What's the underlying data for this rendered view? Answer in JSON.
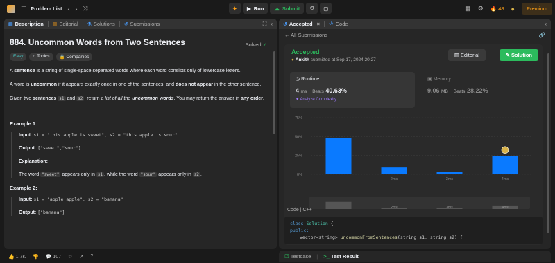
{
  "topbar": {
    "problem_list": "Problem List",
    "run": "Run",
    "submit": "Submit",
    "streak": "48",
    "premium": "Premium"
  },
  "left_tabs": [
    "Description",
    "Editorial",
    "Solutions",
    "Submissions"
  ],
  "problem": {
    "title": "884. Uncommon Words from Two Sentences",
    "solved": "Solved",
    "badges": [
      "Easy",
      "Topics",
      "Companies"
    ],
    "para1_a": "A ",
    "para1_b": "sentence",
    "para1_c": " is a string of single-space separated words where each word consists only of lowercase letters.",
    "para2_a": "A word is ",
    "para2_b": "uncommon",
    "para2_c": " if it appears exactly once in one of the sentences, and ",
    "para2_d": "does not appear",
    "para2_e": " in the other sentence.",
    "para3_a": "Given two ",
    "para3_b": "sentences",
    "para3_c": "s1",
    "para3_d": " and ",
    "para3_e": "s2",
    "para3_f": ", return ",
    "para3_g": "a list of all the ",
    "para3_h": "uncommon words",
    "para3_i": ". You may return the answer in ",
    "para3_j": "any order",
    "para3_k": ".",
    "ex1_title": "Example 1:",
    "ex1_input_lbl": "Input:",
    "ex1_input": "s1 = \"this apple is sweet\", s2 = \"this apple is sour\"",
    "ex1_output_lbl": "Output:",
    "ex1_output": "[\"sweet\",\"sour\"]",
    "ex1_expl_lbl": "Explanation:",
    "ex1_expl_a": "The word ",
    "ex1_expl_b": "\"sweet\"",
    "ex1_expl_c": " appears only in ",
    "ex1_expl_d": "s1",
    "ex1_expl_e": ", while the word ",
    "ex1_expl_f": "\"sour\"",
    "ex1_expl_g": " appears only in ",
    "ex1_expl_h": "s2",
    "ex1_expl_i": ".",
    "ex2_title": "Example 2:",
    "ex2_input_lbl": "Input:",
    "ex2_input": "s1 = \"apple apple\", s2 = \"banana\"",
    "ex2_output_lbl": "Output:",
    "ex2_output": "[\"banana\"]"
  },
  "left_footer": {
    "likes": "1.7K",
    "comments": "107"
  },
  "right_tabs": {
    "accepted": "Accepted",
    "code": "Code"
  },
  "submission": {
    "all_submissions": "All Submissions",
    "status": "Accepted",
    "user": "Ankith",
    "submitted_at": "submitted at Sep 17, 2024 20:27",
    "editorial": "Editorial",
    "solution": "Solution",
    "runtime_label": "Runtime",
    "runtime_value": "4",
    "runtime_unit": "ms",
    "runtime_beats_lbl": "Beats",
    "runtime_beats": "40.63%",
    "analyze": "Analyze Complexity",
    "memory_label": "Memory",
    "memory_value": "9.06",
    "memory_unit": "MB",
    "memory_beats_lbl": "Beats",
    "memory_beats": "28.22%"
  },
  "chart_data": {
    "type": "bar",
    "categories": [
      "",
      "2ms",
      "3ms",
      "4ms"
    ],
    "values": [
      48,
      9,
      3,
      24
    ],
    "ylim": [
      0,
      75
    ],
    "yticks": [
      "75%",
      "50%",
      "25%",
      "0%"
    ],
    "bar_color": "#0a7aff",
    "highlight_index": 3
  },
  "code": {
    "label": "Code",
    "lang": "C++",
    "line1_kw": "class",
    "line1_name": "Solution",
    "line1_end": " {",
    "line2": "public:",
    "line3_type": "vector<string>",
    "line3_fn": "uncommonFromSentences",
    "line3_args": "(string s1, string s2) {"
  },
  "testbar": {
    "testcase": "Testcase",
    "test_result": "Test Result"
  }
}
